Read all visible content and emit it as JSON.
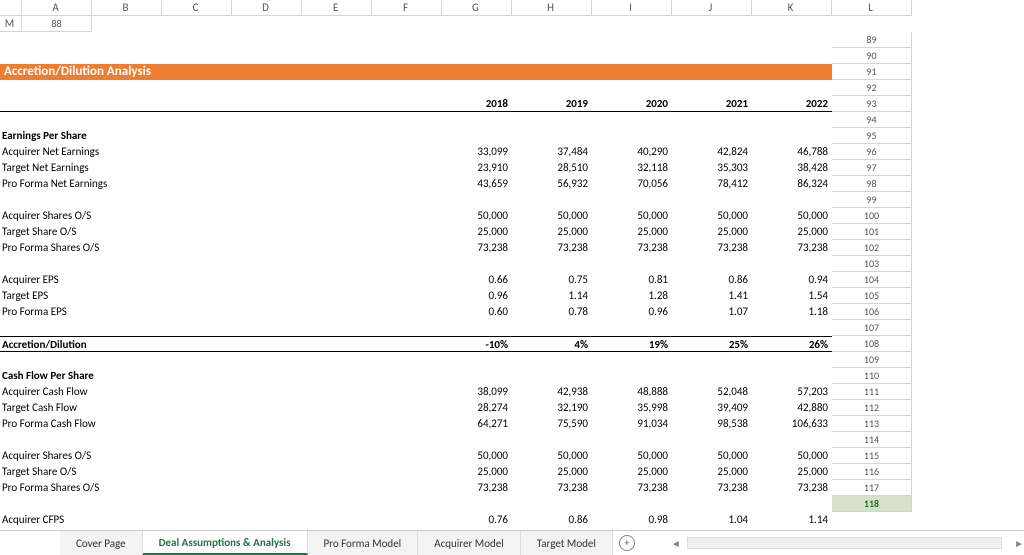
{
  "columns": [
    "",
    "A",
    "B",
    "C",
    "D",
    "E",
    "F",
    "G",
    "H",
    "I",
    "J",
    "K",
    "L",
    "M"
  ],
  "rows": {
    "r88": {
      "label": "88"
    },
    "r89": {
      "label": "89"
    },
    "r90": {
      "label": "90",
      "title": "Accretion/Dilution Analysis"
    },
    "r91": {
      "label": "91"
    },
    "r92": {
      "label": "92",
      "y2018": "2018",
      "y2019": "2019",
      "y2020": "2020",
      "y2021": "2021",
      "y2022": "2022"
    },
    "r93": {
      "label": "93"
    },
    "r94": {
      "label": "94",
      "t": "Earnings Per Share"
    },
    "r95": {
      "label": "95",
      "t": "Acquirer Net Earnings",
      "v": [
        "33,099",
        "37,484",
        "40,290",
        "42,824",
        "46,788"
      ]
    },
    "r96": {
      "label": "96",
      "t": "Target Net Earnings",
      "v": [
        "23,910",
        "28,510",
        "32,118",
        "35,303",
        "38,428"
      ]
    },
    "r97": {
      "label": "97",
      "t": "Pro Forma Net Earnings",
      "v": [
        "43,659",
        "56,932",
        "70,056",
        "78,412",
        "86,324"
      ]
    },
    "r98": {
      "label": "98"
    },
    "r99": {
      "label": "99",
      "t": "Acquirer Shares O/S",
      "v": [
        "50,000",
        "50,000",
        "50,000",
        "50,000",
        "50,000"
      ]
    },
    "r100": {
      "label": "100",
      "t": "Target Share O/S",
      "v": [
        "25,000",
        "25,000",
        "25,000",
        "25,000",
        "25,000"
      ]
    },
    "r101": {
      "label": "101",
      "t": "Pro Forma Shares O/S",
      "v": [
        "73,238",
        "73,238",
        "73,238",
        "73,238",
        "73,238"
      ]
    },
    "r102": {
      "label": "102"
    },
    "r103": {
      "label": "103",
      "t": "Acquirer EPS",
      "v": [
        "0.66",
        "0.75",
        "0.81",
        "0.86",
        "0.94"
      ]
    },
    "r104": {
      "label": "104",
      "t": "Target EPS",
      "v": [
        "0.96",
        "1.14",
        "1.28",
        "1.41",
        "1.54"
      ]
    },
    "r105": {
      "label": "105",
      "t": "Pro Forma EPS",
      "v": [
        "0.60",
        "0.78",
        "0.96",
        "1.07",
        "1.18"
      ]
    },
    "r106": {
      "label": "106"
    },
    "r107": {
      "label": "107",
      "t": "Accretion/Dilution",
      "v": [
        "-10%",
        "4%",
        "19%",
        "25%",
        "26%"
      ]
    },
    "r108": {
      "label": "108"
    },
    "r109": {
      "label": "109",
      "t": "Cash Flow Per Share"
    },
    "r110": {
      "label": "110",
      "t": "Acquirer Cash Flow",
      "v": [
        "38,099",
        "42,938",
        "48,888",
        "52,048",
        "57,203"
      ]
    },
    "r111": {
      "label": "111",
      "t": "Target Cash Flow",
      "v": [
        "28,274",
        "32,190",
        "35,998",
        "39,409",
        "42,880"
      ]
    },
    "r112": {
      "label": "112",
      "t": "Pro Forma Cash Flow",
      "v": [
        "64,271",
        "75,590",
        "91,034",
        "98,538",
        "106,633"
      ]
    },
    "r113": {
      "label": "113"
    },
    "r114": {
      "label": "114",
      "t": "Acquirer Shares O/S",
      "v": [
        "50,000",
        "50,000",
        "50,000",
        "50,000",
        "50,000"
      ]
    },
    "r115": {
      "label": "115",
      "t": "Target Share O/S",
      "v": [
        "25,000",
        "25,000",
        "25,000",
        "25,000",
        "25,000"
      ]
    },
    "r116": {
      "label": "116",
      "t": "Pro Forma Shares O/S",
      "v": [
        "73,238",
        "73,238",
        "73,238",
        "73,238",
        "73,238"
      ]
    },
    "r117": {
      "label": "117"
    },
    "r118": {
      "label": "118",
      "t": "Acquirer CFPS",
      "v": [
        "0.76",
        "0.86",
        "0.98",
        "1.04",
        "1.14"
      ]
    }
  },
  "tabs": {
    "t0": "Cover Page",
    "t1": "Deal Assumptions & Analysis",
    "t2": "Pro Forma Model",
    "t3": "Acquirer Model",
    "t4": "Target Model"
  }
}
